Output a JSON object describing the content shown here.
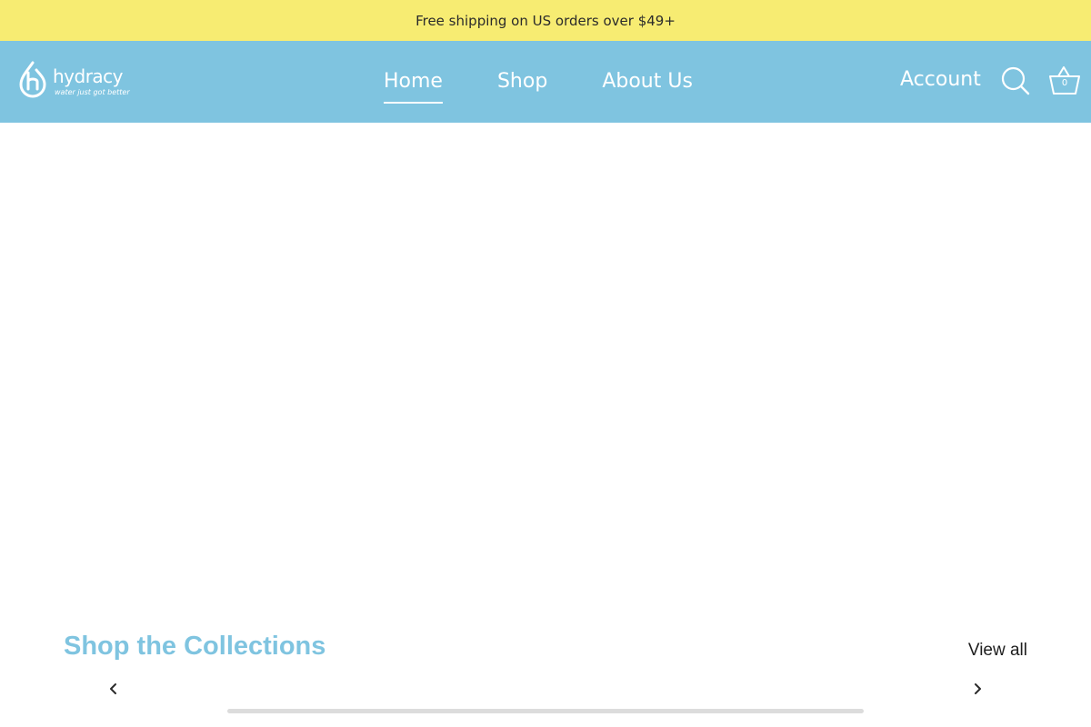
{
  "announcement": {
    "text": "Free shipping on US orders over $49+"
  },
  "header": {
    "logo": {
      "wordmark": "hydracy",
      "tagline": "water just got better"
    },
    "nav": [
      {
        "label": "Home",
        "active": true
      },
      {
        "label": "Shop",
        "active": false
      },
      {
        "label": "About Us",
        "active": false
      }
    ],
    "account_label": "Account",
    "search_icon": "search-icon",
    "cart": {
      "icon": "basket-icon",
      "count": "0"
    }
  },
  "collections": {
    "title": "Shop the Collections",
    "view_all_label": "View all",
    "prev_icon": "chevron-left-icon",
    "next_icon": "chevron-right-icon"
  },
  "colors": {
    "announcement_bg": "#f7ec72",
    "header_bg": "#7fc4e0",
    "accent": "#7fc4e0",
    "text_dark": "#1e1e1e"
  }
}
